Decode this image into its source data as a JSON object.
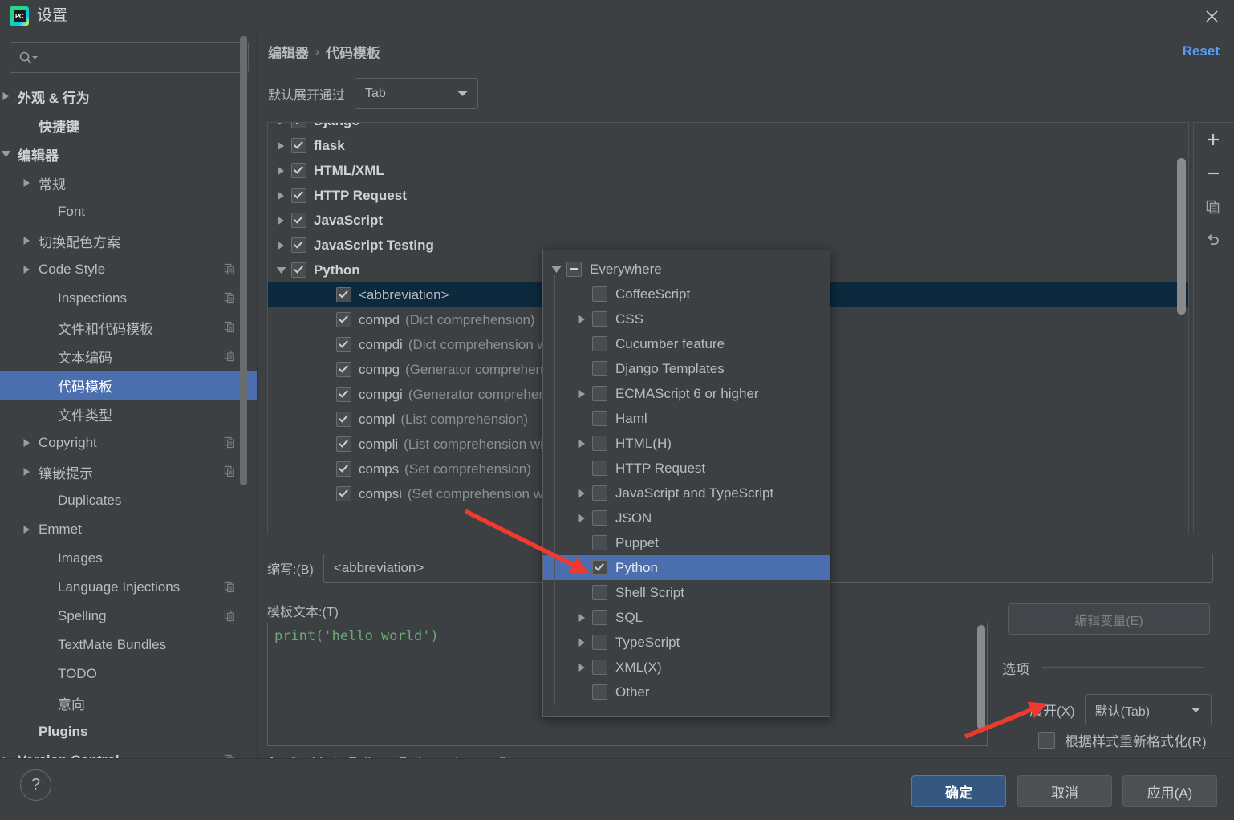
{
  "window": {
    "title": "设置",
    "app_icon": "pycharm-icon",
    "close_icon": "close-icon"
  },
  "sidebar": {
    "search": {
      "placeholder": "",
      "value": "",
      "icon": "search-icon"
    },
    "items": [
      {
        "label": "外观 & 行为",
        "arrow": "right",
        "indent": 22,
        "bold": true,
        "copy": false,
        "selected": false
      },
      {
        "label": "快捷键",
        "arrow": "none",
        "indent": 48,
        "bold": true,
        "copy": false,
        "selected": false
      },
      {
        "label": "编辑器",
        "arrow": "down",
        "indent": 22,
        "bold": true,
        "copy": false,
        "selected": false
      },
      {
        "label": "常规",
        "arrow": "right",
        "indent": 48,
        "bold": false,
        "copy": false,
        "selected": false
      },
      {
        "label": "Font",
        "arrow": "none",
        "indent": 72,
        "bold": false,
        "copy": false,
        "selected": false
      },
      {
        "label": "切换配色方案",
        "arrow": "right",
        "indent": 48,
        "bold": false,
        "copy": false,
        "selected": false
      },
      {
        "label": "Code Style",
        "arrow": "right",
        "indent": 48,
        "bold": false,
        "copy": true,
        "selected": false
      },
      {
        "label": "Inspections",
        "arrow": "none",
        "indent": 72,
        "bold": false,
        "copy": true,
        "selected": false
      },
      {
        "label": "文件和代码模板",
        "arrow": "none",
        "indent": 72,
        "bold": false,
        "copy": true,
        "selected": false
      },
      {
        "label": "文本编码",
        "arrow": "none",
        "indent": 72,
        "bold": false,
        "copy": true,
        "selected": false
      },
      {
        "label": "代码模板",
        "arrow": "none",
        "indent": 72,
        "bold": false,
        "copy": false,
        "selected": true
      },
      {
        "label": "文件类型",
        "arrow": "none",
        "indent": 72,
        "bold": false,
        "copy": false,
        "selected": false
      },
      {
        "label": "Copyright",
        "arrow": "right",
        "indent": 48,
        "bold": false,
        "copy": true,
        "selected": false
      },
      {
        "label": "镶嵌提示",
        "arrow": "right",
        "indent": 48,
        "bold": false,
        "copy": true,
        "selected": false
      },
      {
        "label": "Duplicates",
        "arrow": "none",
        "indent": 72,
        "bold": false,
        "copy": false,
        "selected": false
      },
      {
        "label": "Emmet",
        "arrow": "right",
        "indent": 48,
        "bold": false,
        "copy": false,
        "selected": false
      },
      {
        "label": "Images",
        "arrow": "none",
        "indent": 72,
        "bold": false,
        "copy": false,
        "selected": false
      },
      {
        "label": "Language Injections",
        "arrow": "none",
        "indent": 72,
        "bold": false,
        "copy": true,
        "selected": false
      },
      {
        "label": "Spelling",
        "arrow": "none",
        "indent": 72,
        "bold": false,
        "copy": true,
        "selected": false
      },
      {
        "label": "TextMate Bundles",
        "arrow": "none",
        "indent": 72,
        "bold": false,
        "copy": false,
        "selected": false
      },
      {
        "label": "TODO",
        "arrow": "none",
        "indent": 72,
        "bold": false,
        "copy": false,
        "selected": false
      },
      {
        "label": "意向",
        "arrow": "none",
        "indent": 72,
        "bold": false,
        "copy": false,
        "selected": false
      },
      {
        "label": "Plugins",
        "arrow": "none",
        "indent": 48,
        "bold": true,
        "copy": false,
        "selected": false
      },
      {
        "label": "Version Control",
        "arrow": "right",
        "indent": 22,
        "bold": true,
        "copy": true,
        "selected": false
      }
    ]
  },
  "main": {
    "breadcrumb": {
      "parent": "编辑器",
      "separator": "›",
      "current": "代码模板"
    },
    "reset_label": "Reset",
    "expand_by": {
      "label": "默认展开通过",
      "value": "Tab",
      "caret_icon": "chevron-down-icon"
    },
    "toolbar": [
      {
        "name": "add-template-button",
        "icon": "plus-icon"
      },
      {
        "name": "remove-template-button",
        "icon": "minus-icon"
      },
      {
        "name": "duplicate-template-button",
        "icon": "copy-icon"
      },
      {
        "name": "revert-template-button",
        "icon": "undo-icon"
      }
    ],
    "templates": [
      {
        "label": "Django",
        "desc": "",
        "arrow": "right",
        "checked": true,
        "group": true,
        "indent": 8,
        "selected": false
      },
      {
        "label": "flask",
        "desc": "",
        "arrow": "right",
        "checked": true,
        "group": true,
        "indent": 8,
        "selected": false
      },
      {
        "label": "HTML/XML",
        "desc": "",
        "arrow": "right",
        "checked": true,
        "group": true,
        "indent": 8,
        "selected": false
      },
      {
        "label": "HTTP Request",
        "desc": "",
        "arrow": "right",
        "checked": true,
        "group": true,
        "indent": 8,
        "selected": false
      },
      {
        "label": "JavaScript",
        "desc": "",
        "arrow": "right",
        "checked": true,
        "group": true,
        "indent": 8,
        "selected": false
      },
      {
        "label": "JavaScript Testing",
        "desc": "",
        "arrow": "right",
        "checked": true,
        "group": true,
        "indent": 8,
        "selected": false
      },
      {
        "label": "Python",
        "desc": "",
        "arrow": "down",
        "checked": true,
        "group": true,
        "indent": 8,
        "selected": false
      },
      {
        "label": "<abbreviation>",
        "desc": "",
        "arrow": "none",
        "checked": true,
        "group": false,
        "indent": 64,
        "selected": true
      },
      {
        "label": "compd",
        "desc": "(Dict comprehension)",
        "arrow": "none",
        "checked": true,
        "group": false,
        "indent": 64,
        "selected": false
      },
      {
        "label": "compdi",
        "desc": "(Dict comprehension with if)",
        "arrow": "none",
        "checked": true,
        "group": false,
        "indent": 64,
        "selected": false
      },
      {
        "label": "compg",
        "desc": "(Generator comprehension)",
        "arrow": "none",
        "checked": true,
        "group": false,
        "indent": 64,
        "selected": false
      },
      {
        "label": "compgi",
        "desc": "(Generator comprehension with if)",
        "arrow": "none",
        "checked": true,
        "group": false,
        "indent": 64,
        "selected": false
      },
      {
        "label": "compl",
        "desc": "(List comprehension)",
        "arrow": "none",
        "checked": true,
        "group": false,
        "indent": 64,
        "selected": false
      },
      {
        "label": "compli",
        "desc": "(List comprehension with if)",
        "arrow": "none",
        "checked": true,
        "group": false,
        "indent": 64,
        "selected": false
      },
      {
        "label": "comps",
        "desc": "(Set comprehension)",
        "arrow": "none",
        "checked": true,
        "group": false,
        "indent": 64,
        "selected": false
      },
      {
        "label": "compsi",
        "desc": "(Set comprehension with if)",
        "arrow": "none",
        "checked": true,
        "group": false,
        "indent": 64,
        "selected": false
      }
    ],
    "abbreviation": {
      "label": "缩写:(B)",
      "value": "<abbreviation>"
    },
    "template_text": {
      "label": "模板文本:(T)",
      "value": "print('hello world')"
    },
    "applicable": {
      "text": "Applicable in Python; Python: class.",
      "change_label": "Change",
      "change_caret": "chevron-down-icon"
    },
    "edit_variables_label": "编辑变量(E)",
    "options": {
      "title": "选项",
      "expand_label": "展开(X)",
      "expand_value": "默认(Tab)",
      "expand_caret": "chevron-down-icon",
      "reformat_label": "根据样式重新格式化(R)",
      "reformat_checked": false
    }
  },
  "popup": {
    "items": [
      {
        "label": "Everywhere",
        "arrow": "down",
        "state": "indeterminate",
        "indent": 8,
        "selected": false
      },
      {
        "label": "CoffeeScript",
        "arrow": "none",
        "state": "unchecked",
        "indent": 40,
        "selected": false
      },
      {
        "label": "CSS",
        "arrow": "right",
        "state": "unchecked",
        "indent": 40,
        "selected": false
      },
      {
        "label": "Cucumber feature",
        "arrow": "none",
        "state": "unchecked",
        "indent": 40,
        "selected": false
      },
      {
        "label": "Django Templates",
        "arrow": "none",
        "state": "unchecked",
        "indent": 40,
        "selected": false
      },
      {
        "label": "ECMAScript 6 or higher",
        "arrow": "right",
        "state": "unchecked",
        "indent": 40,
        "selected": false
      },
      {
        "label": "Haml",
        "arrow": "none",
        "state": "unchecked",
        "indent": 40,
        "selected": false
      },
      {
        "label": "HTML(H)",
        "arrow": "right",
        "state": "unchecked",
        "indent": 40,
        "selected": false
      },
      {
        "label": "HTTP Request",
        "arrow": "none",
        "state": "unchecked",
        "indent": 40,
        "selected": false
      },
      {
        "label": "JavaScript and TypeScript",
        "arrow": "right",
        "state": "unchecked",
        "indent": 40,
        "selected": false
      },
      {
        "label": "JSON",
        "arrow": "right",
        "state": "unchecked",
        "indent": 40,
        "selected": false
      },
      {
        "label": "Puppet",
        "arrow": "none",
        "state": "unchecked",
        "indent": 40,
        "selected": false
      },
      {
        "label": "Python",
        "arrow": "right",
        "state": "checked",
        "indent": 40,
        "selected": true
      },
      {
        "label": "Shell Script",
        "arrow": "none",
        "state": "unchecked",
        "indent": 40,
        "selected": false
      },
      {
        "label": "SQL",
        "arrow": "right",
        "state": "unchecked",
        "indent": 40,
        "selected": false
      },
      {
        "label": "TypeScript",
        "arrow": "right",
        "state": "unchecked",
        "indent": 40,
        "selected": false
      },
      {
        "label": "XML(X)",
        "arrow": "right",
        "state": "unchecked",
        "indent": 40,
        "selected": false
      },
      {
        "label": "Other",
        "arrow": "none",
        "state": "unchecked",
        "indent": 40,
        "selected": false
      }
    ]
  },
  "footer": {
    "help_label": "?",
    "ok_label": "确定",
    "cancel_label": "取消",
    "apply_label": "应用(A)"
  },
  "colors": {
    "selection_blue": "#4b6eaf",
    "tree_selection": "#0d293e",
    "link_blue": "#589df6",
    "ok_button": "#365880",
    "annotation_red": "#f03a2f",
    "code_green": "#6aab73",
    "background": "#3c4043"
  }
}
